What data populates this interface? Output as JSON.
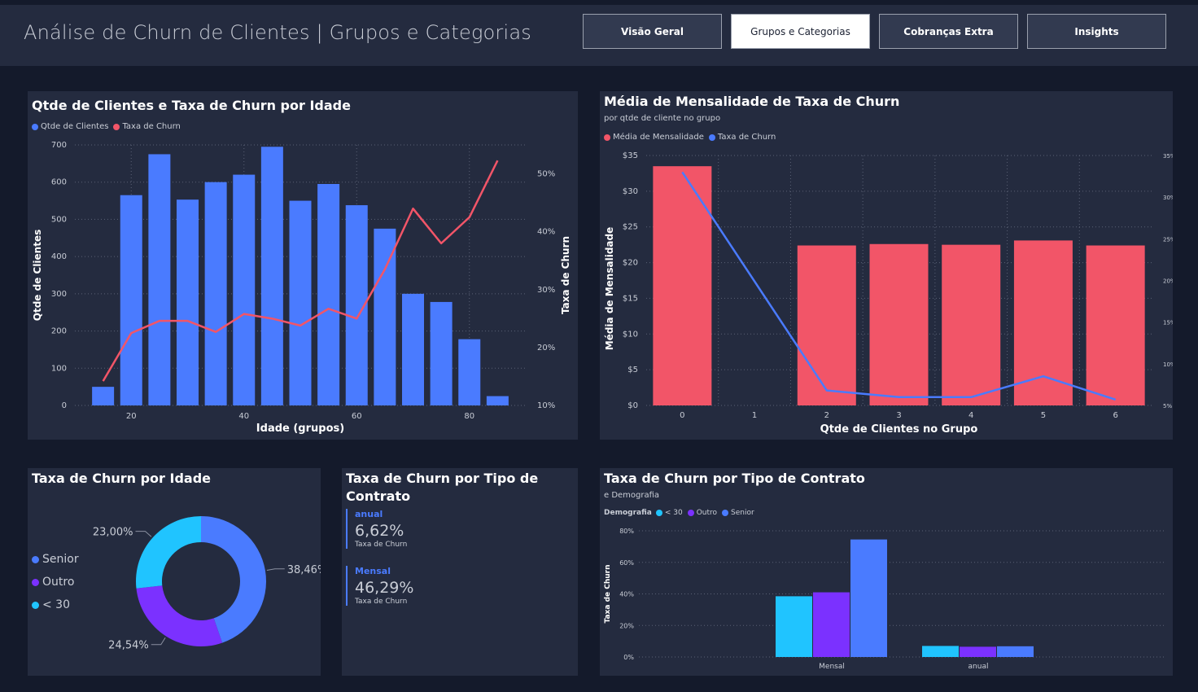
{
  "header": {
    "title": "Análise de Churn de Clientes | Grupos e Categorias",
    "nav": [
      {
        "label": "Visão Geral",
        "active": false
      },
      {
        "label": "Grupos e Categorias",
        "active": true
      },
      {
        "label": "Cobranças Extra",
        "active": false
      },
      {
        "label": "Insights",
        "active": false
      }
    ]
  },
  "colors": {
    "blue": "#4a7bff",
    "red": "#f25568",
    "cyan": "#20c4ff",
    "purple": "#7b31ff",
    "background": "#141a2b",
    "card": "#242b3f"
  },
  "age_chart": {
    "title": "Qtde de Clientes e Taxa de Churn por Idade",
    "legend": [
      "Qtde de Clientes",
      "Taxa de Churn"
    ],
    "xlabel": "Idade (grupos)",
    "ylabel": "Qtde de Clientes",
    "y2label": "Taxa de Churn",
    "y_ticks": [
      "0",
      "100",
      "200",
      "300",
      "400",
      "500",
      "600",
      "700"
    ],
    "y2_ticks": [
      "10%",
      "20%",
      "30%",
      "40%",
      "50%"
    ],
    "x_ticks": [
      "20",
      "40",
      "60",
      "80"
    ]
  },
  "fee_chart": {
    "title": "Média de Mensalidade de Taxa de Churn",
    "subtitle": "por qtde de cliente no grupo",
    "legend": [
      "Média de Mensalidade",
      "Taxa de Churn"
    ],
    "xlabel": "Qtde de Clientes no Grupo",
    "ylabel": "Média de Mensalidade",
    "y_ticks": [
      "$0",
      "$5",
      "$10",
      "$15",
      "$20",
      "$25",
      "$30",
      "$35"
    ],
    "y2_ticks": [
      "5%",
      "10%",
      "15%",
      "20%",
      "25%",
      "30%",
      "35%"
    ],
    "x_ticks": [
      "0",
      "1",
      "2",
      "3",
      "4",
      "5",
      "6"
    ]
  },
  "donut": {
    "title": "Taxa de Churn por Idade",
    "legend": [
      "Senior",
      "Outro",
      "< 30"
    ],
    "labels": {
      "senior": "38,46%",
      "outro": "24,54%",
      "under30": "23,00%"
    }
  },
  "contract_kpi": {
    "title_line1": "Taxa de Churn por Tipo de",
    "title_line2": "Contrato",
    "items": [
      {
        "label": "anual",
        "value": "6,62%",
        "sub": "Taxa de Churn"
      },
      {
        "label": "Mensal",
        "value": "46,29%",
        "sub": "Taxa de Churn"
      }
    ]
  },
  "contract_chart": {
    "title": "Taxa de Churn por Tipo de Contrato",
    "subtitle": "e Demografia",
    "legend_title": "Demografia",
    "legend": [
      "< 30",
      "Outro",
      "Senior"
    ],
    "ylabel": "Taxa de Churn",
    "y_ticks": [
      "0%",
      "20%",
      "40%",
      "60%",
      "80%"
    ],
    "x_ticks": [
      "Mensal",
      "anual"
    ]
  },
  "chart_data": [
    {
      "type": "bar",
      "title": "Qtde de Clientes e Taxa de Churn por Idade",
      "xlabel": "Idade (grupos)",
      "ylabel": "Qtde de Clientes",
      "y2label": "Taxa de Churn",
      "x": [
        15,
        20,
        25,
        30,
        35,
        40,
        45,
        50,
        55,
        60,
        65,
        70,
        75,
        80,
        85
      ],
      "series": [
        {
          "name": "Qtde de Clientes",
          "kind": "bar",
          "axis": "left",
          "values": [
            50,
            565,
            675,
            553,
            600,
            620,
            695,
            550,
            595,
            538,
            475,
            300,
            278,
            178,
            25
          ]
        },
        {
          "name": "Taxa de Churn",
          "kind": "line",
          "axis": "right",
          "values": [
            14.2,
            22.5,
            24.6,
            24.6,
            22.7,
            25.8,
            25.0,
            23.8,
            26.7,
            25.0,
            33.5,
            44.0,
            38.0,
            42.5,
            52.3
          ]
        }
      ],
      "ylim": [
        0,
        700
      ],
      "y2lim": [
        10,
        55
      ],
      "xlim": [
        10,
        90
      ],
      "legend_placement": "top-left",
      "grid": true
    },
    {
      "type": "bar",
      "title": "Média de Mensalidade de Taxa de Churn",
      "subtitle": "por qtde de cliente no grupo",
      "xlabel": "Qtde de Clientes no Grupo",
      "ylabel": "Média de Mensalidade",
      "categories": [
        "0",
        "1",
        "2",
        "3",
        "4",
        "5",
        "6"
      ],
      "series": [
        {
          "name": "Média de Mensalidade",
          "kind": "bar",
          "axis": "left",
          "values": [
            33.5,
            null,
            22.4,
            22.6,
            22.5,
            23.1,
            22.4
          ]
        },
        {
          "name": "Taxa de Churn",
          "kind": "line",
          "axis": "right",
          "values": [
            33.0,
            null,
            6.8,
            6.0,
            6.0,
            8.5,
            5.7
          ]
        }
      ],
      "ylim": [
        0,
        35
      ],
      "y2lim": [
        5,
        35
      ],
      "legend_placement": "top-left",
      "grid": true
    },
    {
      "type": "pie",
      "title": "Taxa de Churn por Idade",
      "categories": [
        "Senior",
        "Outro",
        "< 30"
      ],
      "values": [
        38.46,
        24.54,
        23.0
      ],
      "donut": true,
      "legend_placement": "left"
    },
    {
      "type": "bar",
      "title": "Taxa de Churn por Tipo de Contrato",
      "subtitle": "e Demografia",
      "ylabel": "Taxa de Churn",
      "categories": [
        "Mensal",
        "anual"
      ],
      "series": [
        {
          "name": "< 30",
          "values": [
            38.5,
            7.0
          ]
        },
        {
          "name": "Outro",
          "values": [
            41.0,
            6.5
          ]
        },
        {
          "name": "Senior",
          "values": [
            74.5,
            6.8
          ]
        }
      ],
      "ylim": [
        0,
        80
      ],
      "legend_placement": "top-left",
      "grid": true
    }
  ]
}
